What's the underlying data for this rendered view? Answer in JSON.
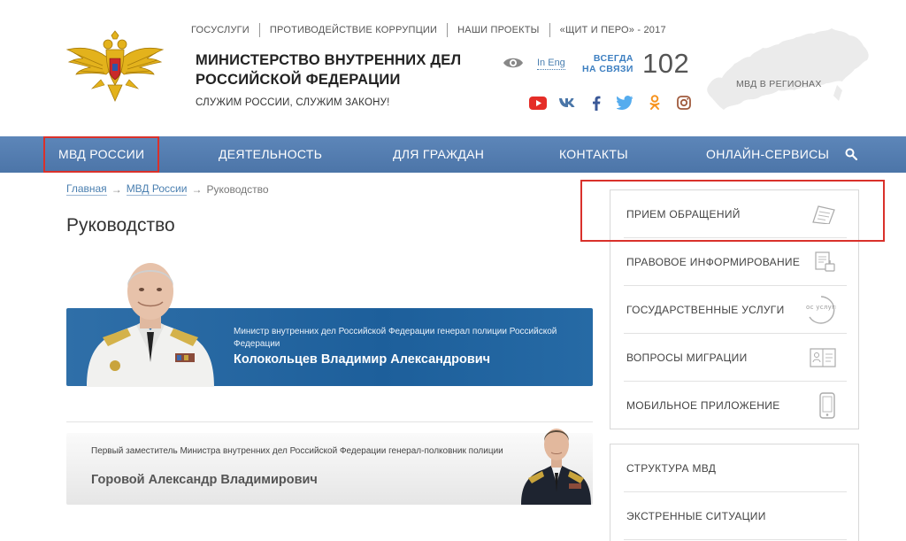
{
  "header": {
    "top_links": [
      "ГОСУСЛУГИ",
      "ПРОТИВОДЕЙСТВИЕ КОРРУПЦИИ",
      "НАШИ ПРОЕКТЫ",
      "«ЩИТ И ПЕРО» - 2017"
    ],
    "org_title_line1": "МИНИСТЕРСТВО ВНУТРЕННИХ ДЕЛ",
    "org_title_line2": "РОССИЙСКОЙ ФЕДЕРАЦИИ",
    "motto": "СЛУЖИМ РОССИИ, СЛУЖИМ ЗАКОНУ!",
    "lang_link": "In Eng",
    "hotline_line1": "ВСЕГДА",
    "hotline_line2": "НА СВЯЗИ",
    "hotline_number": "102",
    "regions_label": "МВД В РЕГИОНАХ",
    "social_icons": [
      "youtube-icon",
      "vk-icon",
      "facebook-icon",
      "twitter-icon",
      "odnoklassniki-icon",
      "instagram-icon"
    ]
  },
  "nav": {
    "items": [
      "МВД РОССИИ",
      "ДЕЯТЕЛЬНОСТЬ",
      "ДЛЯ ГРАЖДАН",
      "КОНТАКТЫ",
      "ОНЛАЙН-СЕРВИСЫ"
    ]
  },
  "breadcrumb": {
    "home": "Главная",
    "section": "МВД России",
    "current": "Руководство",
    "separator": "→"
  },
  "page": {
    "title": "Руководство"
  },
  "leaders": [
    {
      "rank": "Министр внутренних дел Российской Федерации генерал полиции Российской Федерации",
      "name": "Колокольцев Владимир Александрович"
    },
    {
      "rank": "Первый заместитель Министра внутренних дел Российской Федерации генерал-полковник полиции",
      "name": "Горовой Александр Владимирович"
    }
  ],
  "sidebar": {
    "services": [
      "ПРИЕМ ОБРАЩЕНИЙ",
      "ПРАВОВОЕ ИНФОРМИРОВАНИЕ",
      "ГОСУДАРСТВЕННЫЕ УСЛУГИ",
      "ВОПРОСЫ МИГРАЦИИ",
      "МОБИЛЬНОЕ ПРИЛОЖЕНИЕ"
    ],
    "sections": [
      "СТРУКТУРА МВД",
      "ЭКСТРЕННЫЕ СИТУАЦИИ"
    ],
    "gosuslugi_icon_text": "гос услуги"
  },
  "colors": {
    "nav_blue": "#5079ad",
    "highlight_red": "#d9312b",
    "accent_blue": "#3d7fc1",
    "card_blue": "#1d5f9b"
  }
}
